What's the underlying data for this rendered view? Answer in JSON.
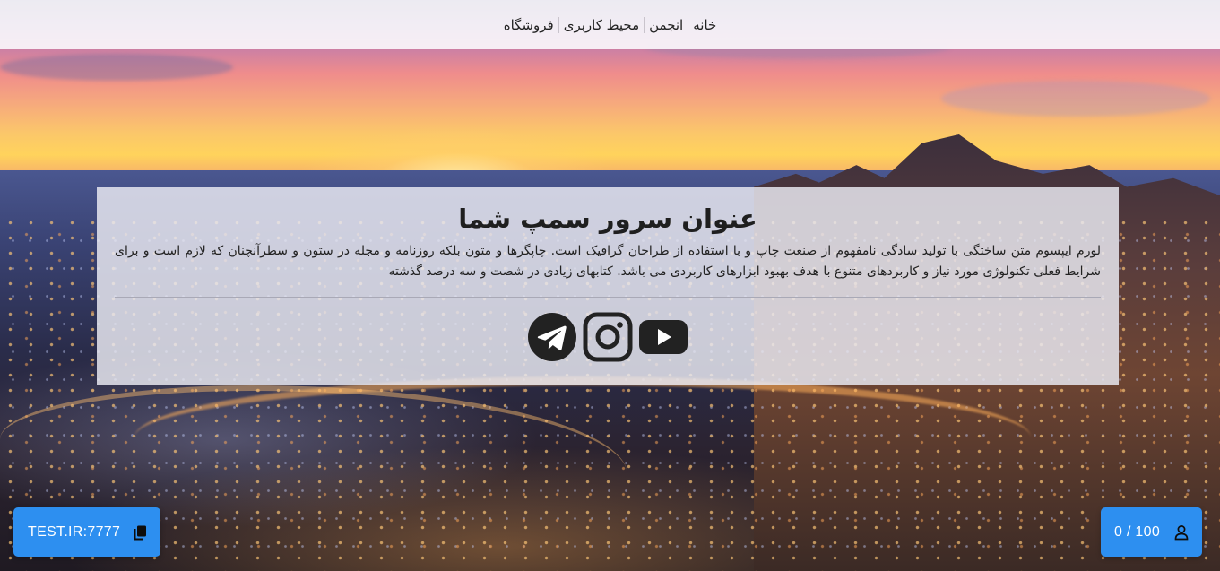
{
  "nav": {
    "items": [
      {
        "label": "خانه"
      },
      {
        "label": "انجمن"
      },
      {
        "label": "محیط کاربری"
      },
      {
        "label": "فروشگاه"
      }
    ]
  },
  "hero": {
    "title": "عنوان سرور سمپ شما",
    "description": "لورم ایپسوم متن ساختگی با تولید سادگی نامفهوم از صنعت چاپ و با استفاده از طراحان گرافیک است. چاپگرها و متون بلکه روزنامه و مجله در ستون و سطرآنچنان که لازم است و برای شرایط فعلی تکنولوژی مورد نیاز و کاربردهای متنوع با هدف بهبود ابزارهای کاربردی می باشد. کتابهای زیادی در شصت و سه درصد گذشته",
    "socials": [
      {
        "icon": "telegram-icon"
      },
      {
        "icon": "instagram-icon"
      },
      {
        "icon": "youtube-icon"
      }
    ]
  },
  "server": {
    "address": "TEST.IR:7777",
    "copy_icon": "copy-icon",
    "players": "0 / 100",
    "players_icon": "user-icon"
  },
  "colors": {
    "button": "#2d8ff0",
    "social_icon": "#222222",
    "panel": "#e9e9f2"
  }
}
